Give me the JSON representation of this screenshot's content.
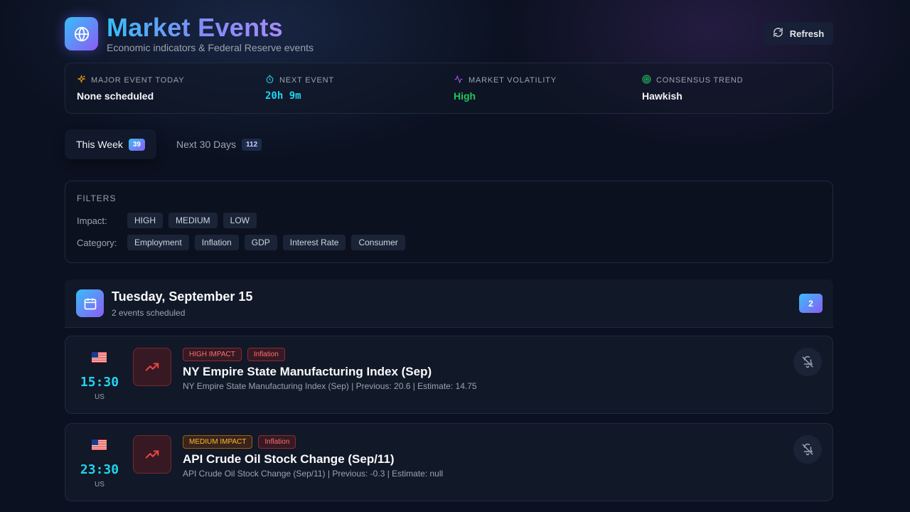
{
  "header": {
    "title": "Market Events",
    "subtitle": "Economic indicators & Federal Reserve events",
    "refresh_label": "Refresh",
    "logo_icon": "globe-icon",
    "refresh_icon": "refresh-icon"
  },
  "stats": [
    {
      "label": "MAJOR EVENT TODAY",
      "value": "None scheduled",
      "icon": "sparkle-icon",
      "icon_color": "#f59e0b"
    },
    {
      "label": "NEXT EVENT",
      "value": "20h 9m",
      "icon": "timer-icon",
      "icon_color": "#22d3ee"
    },
    {
      "label": "MARKET VOLATILITY",
      "value": "High",
      "icon": "activity-icon",
      "icon_color": "#a855f7"
    },
    {
      "label": "CONSENSUS TREND",
      "value": "Hawkish",
      "icon": "target-icon",
      "icon_color": "#22c55e"
    }
  ],
  "tabs": [
    {
      "label": "This Week",
      "count": "39",
      "active": true
    },
    {
      "label": "Next 30 Days",
      "count": "112",
      "active": false
    }
  ],
  "filters": {
    "title": "FILTERS",
    "impact_label": "Impact:",
    "impact_options": [
      "HIGH",
      "MEDIUM",
      "LOW"
    ],
    "category_label": "Category:",
    "category_options": [
      "Employment",
      "Inflation",
      "GDP",
      "Interest Rate",
      "Consumer"
    ]
  },
  "day": {
    "title": "Tuesday, September 15",
    "subtitle": "2 events scheduled",
    "count": "2",
    "icon": "calendar-icon"
  },
  "events": [
    {
      "time": "15:30",
      "country": "US",
      "impact": "HIGH IMPACT",
      "category": "Inflation",
      "title": "NY Empire State Manufacturing Index (Sep)",
      "description": "NY Empire State Manufacturing Index (Sep) | Previous: 20.6 | Estimate: 14.75"
    },
    {
      "time": "23:30",
      "country": "US",
      "impact": "MEDIUM IMPACT",
      "category": "Inflation",
      "title": "API Crude Oil Stock Change (Sep/11)",
      "description": "API Crude Oil Stock Change (Sep/11) | Previous: -0.3 | Estimate: null"
    }
  ],
  "colors": {
    "accent_cyan": "#22d3ee",
    "accent_purple": "#8b5cf6",
    "high_impact": "#f87171",
    "medium_impact": "#fbbf24",
    "volatility_high": "#22c55e",
    "background": "#0b1120"
  }
}
